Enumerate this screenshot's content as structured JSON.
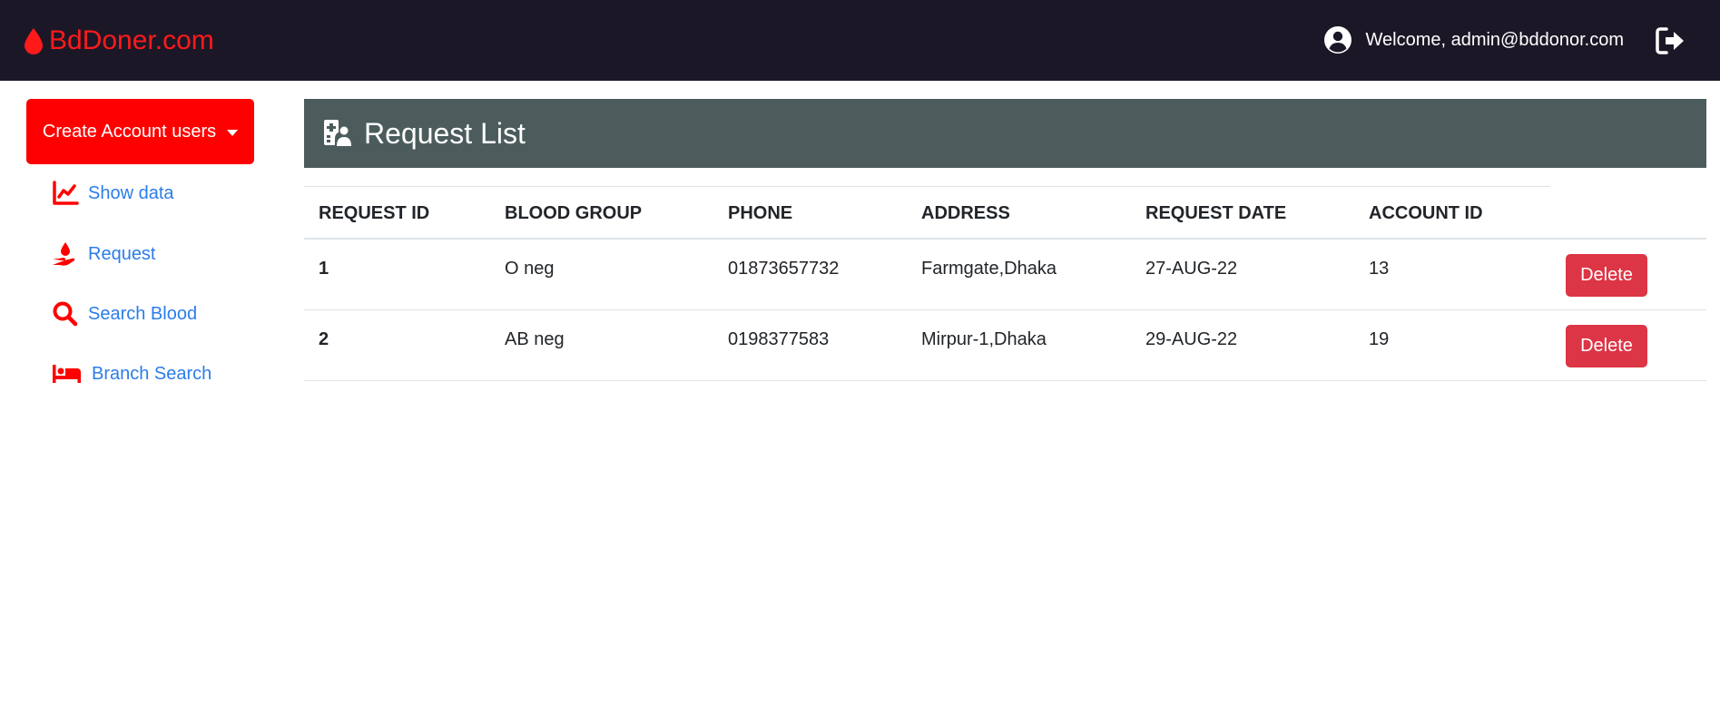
{
  "header": {
    "brand": "BdDoner.com",
    "welcome_text": "Welcome, admin@bddonor.com",
    "colors": {
      "background": "#1c1727",
      "brand": "#ff1a1a"
    },
    "icons": {
      "brand": "blood-drop-icon",
      "user": "user-circle-icon",
      "logout": "logout-icon"
    }
  },
  "sidebar": {
    "dropdown_label": "Create Account users",
    "dropdown_color": "#ff0000",
    "items": [
      {
        "label": "Show data",
        "icon": "chart-line-icon"
      },
      {
        "label": "Request",
        "icon": "hand-holding-droplet-icon"
      },
      {
        "label": "Search Blood",
        "icon": "search-icon"
      },
      {
        "label": "Branch Search",
        "icon": "bed-icon"
      }
    ]
  },
  "main": {
    "title": "Request List",
    "title_icon": "hospital-user-icon",
    "header_color": "#4c5c5c",
    "table": {
      "columns": [
        "REQUEST ID",
        "BLOOD GROUP",
        "PHONE",
        "ADDRESS",
        "REQUEST DATE",
        "ACCOUNT ID"
      ],
      "rows": [
        {
          "request_id": "1",
          "blood_group": "O neg",
          "phone": "01873657732",
          "address": "Farmgate,Dhaka",
          "request_date": "27-AUG-22",
          "account_id": "13",
          "action": "Delete"
        },
        {
          "request_id": "2",
          "blood_group": "AB neg",
          "phone": "0198377583",
          "address": "Mirpur-1,Dhaka",
          "request_date": "29-AUG-22",
          "account_id": "19",
          "action": "Delete"
        }
      ],
      "delete_color": "#dc3545"
    }
  }
}
